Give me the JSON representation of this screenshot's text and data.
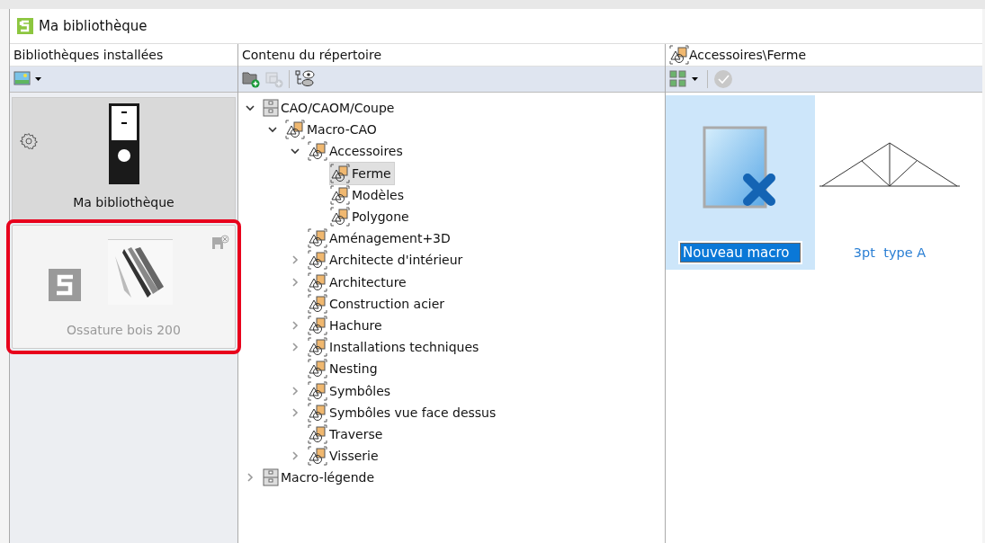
{
  "window": {
    "title": "Ma bibliothèque"
  },
  "panels": {
    "libraries": "Bibliothèques installées",
    "content": "Contenu du répertoire",
    "path": "Accessoires\\Ferme"
  },
  "libraries": [
    {
      "name": "Ma bibliothèque",
      "kind": "binder",
      "selected": true,
      "disabled": false,
      "highlighted": false
    },
    {
      "name": "Ossature bois 200",
      "kind": "product",
      "selected": false,
      "disabled": true,
      "highlighted": true
    }
  ],
  "tree": [
    {
      "label": "CAO/CAOM/Coupe",
      "kind": "cabinet",
      "expandable": true,
      "expanded": true,
      "selected": false,
      "children": [
        {
          "label": "Macro-CAO",
          "kind": "macro",
          "expandable": true,
          "expanded": true,
          "selected": false,
          "children": [
            {
              "label": "Accessoires",
              "kind": "macro",
              "expandable": true,
              "expanded": true,
              "selected": false,
              "children": [
                {
                  "label": "Ferme",
                  "kind": "macro",
                  "expandable": false,
                  "expanded": false,
                  "selected": true
                },
                {
                  "label": "Modèles",
                  "kind": "macro",
                  "expandable": false,
                  "expanded": false,
                  "selected": false
                },
                {
                  "label": "Polygone",
                  "kind": "macro",
                  "expandable": false,
                  "expanded": false,
                  "selected": false
                }
              ]
            },
            {
              "label": "Aménagement+3D",
              "kind": "macro",
              "expandable": false,
              "expanded": false,
              "selected": false
            },
            {
              "label": "Architecte d'intérieur",
              "kind": "macro",
              "expandable": true,
              "expanded": false,
              "selected": false
            },
            {
              "label": "Architecture",
              "kind": "macro",
              "expandable": true,
              "expanded": false,
              "selected": false
            },
            {
              "label": "Construction acier",
              "kind": "macro",
              "expandable": false,
              "expanded": false,
              "selected": false
            },
            {
              "label": "Hachure",
              "kind": "macro",
              "expandable": true,
              "expanded": false,
              "selected": false
            },
            {
              "label": "Installations techniques",
              "kind": "macro",
              "expandable": true,
              "expanded": false,
              "selected": false
            },
            {
              "label": "Nesting",
              "kind": "macro",
              "expandable": false,
              "expanded": false,
              "selected": false
            },
            {
              "label": "Symbôles",
              "kind": "macro",
              "expandable": true,
              "expanded": false,
              "selected": false
            },
            {
              "label": "Symbôles vue face dessus",
              "kind": "macro",
              "expandable": true,
              "expanded": false,
              "selected": false
            },
            {
              "label": "Traverse",
              "kind": "macro",
              "expandable": false,
              "expanded": false,
              "selected": false
            },
            {
              "label": "Visserie",
              "kind": "macro",
              "expandable": true,
              "expanded": false,
              "selected": false
            }
          ]
        }
      ]
    },
    {
      "label": "Macro-légende",
      "kind": "cabinet",
      "expandable": true,
      "expanded": false,
      "selected": false
    }
  ],
  "macros": [
    {
      "name": "Nouveau macro",
      "kind": "new",
      "selected": true,
      "editing": true
    },
    {
      "name": "3pt  type A",
      "kind": "truss",
      "selected": false,
      "editing": false
    }
  ]
}
